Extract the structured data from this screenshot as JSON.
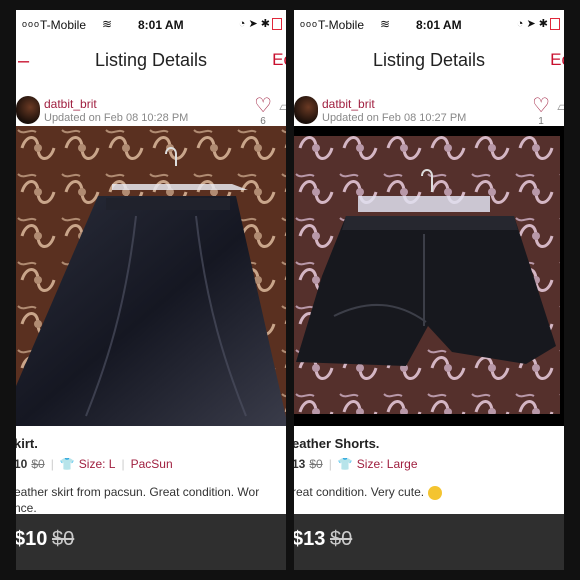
{
  "status_bar": {
    "dots": "ooo",
    "carrier": "T-Mobile",
    "time": "8:01 AM"
  },
  "listings": [
    {
      "nav": {
        "back": "–",
        "title": "Listing Details",
        "edit": "Ec"
      },
      "seller": {
        "username": "datbit_brit",
        "updated": "Updated on Feb 08 10:28 PM"
      },
      "likes": {
        "count": "6"
      },
      "product": {
        "title": "kirt.",
        "price": "10",
        "original_price": "$0",
        "size": "Size: L",
        "brand": "PacSun",
        "description_line1": "eather skirt from pacsun. Great condition. Wor",
        "description_line2": "nce."
      },
      "buy_bar": {
        "price": "$10",
        "original_price": "$0"
      }
    },
    {
      "nav": {
        "back": "",
        "title": "Listing Details",
        "edit": "Ec"
      },
      "seller": {
        "username": "datbit_brit",
        "updated": "Updated on Feb 08 10:27 PM"
      },
      "likes": {
        "count": "1"
      },
      "product": {
        "title": "eather Shorts.",
        "price": "13",
        "original_price": "$0",
        "size": "Size: Large",
        "brand": "",
        "description_line1": "reat condition. Very cute.",
        "description_line2": ""
      },
      "buy_bar": {
        "price": "$13",
        "original_price": "$0"
      }
    }
  ],
  "colors": {
    "accent": "#a02040",
    "nav_red": "#c8102e",
    "buy_bar": "#2f2f2f"
  }
}
